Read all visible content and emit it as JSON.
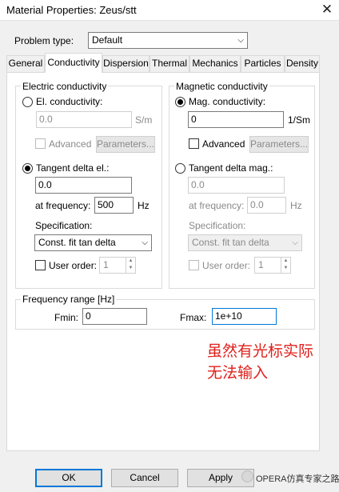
{
  "window": {
    "title": "Material Properties: Zeus/stt",
    "close_glyph": "✕"
  },
  "problem_type": {
    "label": "Problem type:",
    "value": "Default"
  },
  "tabs": [
    "General",
    "Conductivity",
    "Dispersion",
    "Thermal",
    "Mechanics",
    "Particles",
    "Density"
  ],
  "active_tab": "Conductivity",
  "electric": {
    "legend": "Electric conductivity",
    "el_cond_label": "El. conductivity:",
    "el_cond_value": "0.0",
    "el_cond_unit": "S/m",
    "advanced_label": "Advanced",
    "parameters_label": "Parameters...",
    "tangent_label": "Tangent delta el.:",
    "tangent_value": "0.0",
    "at_freq_label": "at frequency:",
    "at_freq_value": "500",
    "at_freq_unit": "Hz",
    "spec_label": "Specification:",
    "spec_value": "Const. fit tan delta",
    "user_order_label": "User order:",
    "user_order_value": "1"
  },
  "magnetic": {
    "legend": "Magnetic conductivity",
    "mag_cond_label": "Mag. conductivity:",
    "mag_cond_value": "0",
    "mag_cond_unit": "1/Sm",
    "advanced_label": "Advanced",
    "parameters_label": "Parameters...",
    "tangent_label": "Tangent delta mag.:",
    "tangent_value": "0.0",
    "at_freq_label": "at frequency:",
    "at_freq_value": "0.0",
    "at_freq_unit": "Hz",
    "spec_label": "Specification:",
    "spec_value": "Const. fit tan delta",
    "user_order_label": "User order:",
    "user_order_value": "1"
  },
  "frequency": {
    "legend": "Frequency range [Hz]",
    "fmin_label": "Fmin:",
    "fmin_value": "0",
    "fmax_label": "Fmax:",
    "fmax_value": "1e+10"
  },
  "annotation": {
    "line1": "虽然有光标实际",
    "line2": "无法输入"
  },
  "buttons": {
    "ok": "OK",
    "cancel": "Cancel",
    "apply": "Apply"
  },
  "watermark": "OPERA仿真专家之路",
  "colors": {
    "annotation": "#e0201c",
    "focus": "#0078d7"
  },
  "icons": {
    "dropdown": "chevron-down-icon",
    "close": "close-icon",
    "spinner": "spinner-arrows-icon"
  }
}
